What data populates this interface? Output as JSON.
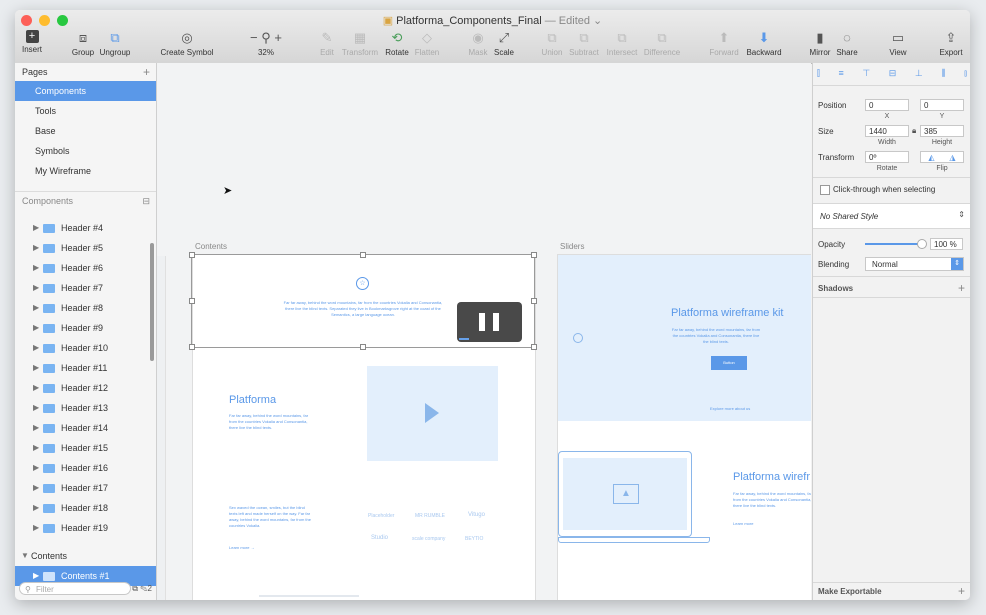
{
  "window": {
    "title": "Platforma_Components_Final",
    "status": "— Edited"
  },
  "toolbar": {
    "insert": "Insert",
    "group": "Group",
    "ungroup": "Ungroup",
    "create_symbol": "Create Symbol",
    "zoom": "32%",
    "edit": "Edit",
    "transform": "Transform",
    "rotate": "Rotate",
    "flatten": "Flatten",
    "mask": "Mask",
    "scale": "Scale",
    "union": "Union",
    "subtract": "Subtract",
    "intersect": "Intersect",
    "difference": "Difference",
    "forward": "Forward",
    "backward": "Backward",
    "mirror": "Mirror",
    "share": "Share",
    "view": "View",
    "export": "Export"
  },
  "pages": {
    "header": "Pages",
    "items": [
      "Components",
      "Tools",
      "Base",
      "Symbols",
      "My Wireframe"
    ],
    "selected": "Components"
  },
  "layers": {
    "header": "Components",
    "items": [
      "Header #4",
      "Header #5",
      "Header #6",
      "Header #7",
      "Header #8",
      "Header #9",
      "Header #10",
      "Header #11",
      "Header #12",
      "Header #13",
      "Header #14",
      "Header #15",
      "Header #16",
      "Header #17",
      "Header #18",
      "Header #19"
    ],
    "group_label": "Contents",
    "selected_item": "Contents #1",
    "filter_placeholder": "Filter",
    "filter_count": "2"
  },
  "canvas": {
    "artboard_contents": "Contents",
    "artboard_sliders": "Sliders",
    "hero_text": "Far far away, behind the word mountains, far from the countries Vokalia and Consonantia, there live the blind texts. Separated they live in Bookmarksgrove right at the coast of the Semantics, a large language ocean.",
    "platforma_title": "Platforma",
    "platforma_body": "Far far away, behind the word mountains, far from the countries Vokalia and Consonantia, there live the blind texts.",
    "platforma_body2": "Sex waved the ocean, smiles, but the blind texts left and made herself on the way. Far far away, behind the word mountains, far from the countries Vokalia.",
    "learn_more": "Learn more →",
    "logos": [
      "Placeholder",
      "MR RUMBLE",
      "Vitugo",
      "Studio",
      "scale company",
      "BEYTIO"
    ],
    "slider_title": "Platforma wireframe kit",
    "slider_body": "Far far away, behind the word mountains, far from the countries Vokalia and Consonantia, there live the blind texts.",
    "slider_button": "Button",
    "slider_small": "Explore more about us",
    "slider_title2": "Platforma wirefr",
    "slider_body2": "Far far away, behind the word mountains, far from the countries Vokalia and Consonantia, there live the blind texts.",
    "learn_more2": "Learn more"
  },
  "inspector": {
    "position_label": "Position",
    "x": "0",
    "y": "0",
    "x_label": "X",
    "y_label": "Y",
    "size_label": "Size",
    "width": "1440",
    "height": "385",
    "width_label": "Width",
    "height_label": "Height",
    "transform_label": "Transform",
    "rotate": "0º",
    "rotate_label": "Rotate",
    "flip_label": "Flip",
    "click_through": "Click-through when selecting",
    "shared_style": "No Shared Style",
    "opacity_label": "Opacity",
    "opacity_value": "100 %",
    "opacity": 1.0,
    "blending_label": "Blending",
    "blending_value": "Normal",
    "shadows_label": "Shadows",
    "export_label": "Make Exportable"
  },
  "colors": {
    "accent": "#5a98e8",
    "wireframe": "#5a98e8",
    "wireframe_fill": "#e3effc"
  }
}
